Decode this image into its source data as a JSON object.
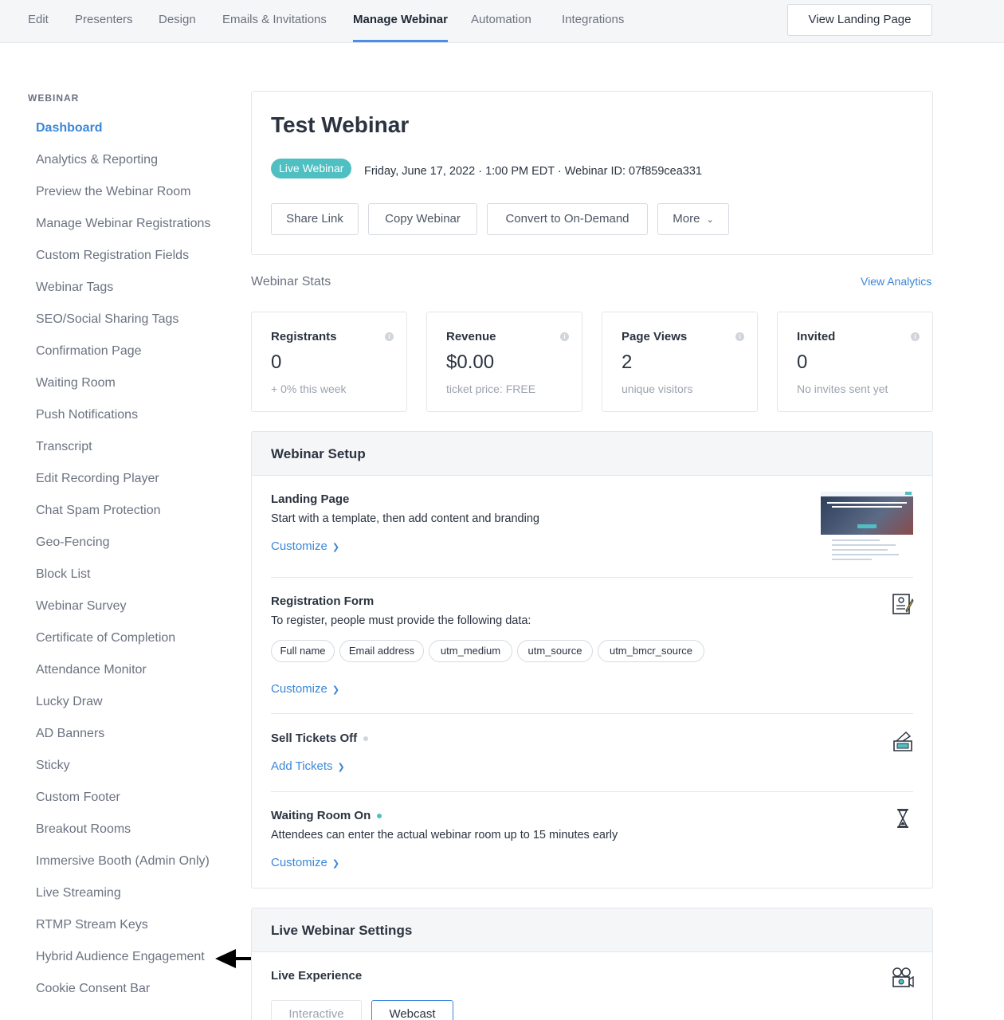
{
  "topnav": {
    "tabs": [
      "Edit",
      "Presenters",
      "Design",
      "Emails & Invitations",
      "Manage Webinar",
      "Automation",
      "Integrations"
    ],
    "active": "Manage Webinar",
    "view_landing": "View Landing Page"
  },
  "sidebar": {
    "heading": "WEBINAR",
    "items": [
      "Dashboard",
      "Analytics & Reporting",
      "Preview the Webinar Room",
      "Manage Webinar Registrations",
      "Custom Registration Fields",
      "Webinar Tags",
      "SEO/Social Sharing Tags",
      "Confirmation Page",
      "Waiting Room",
      "Push Notifications",
      "Transcript",
      "Edit Recording Player",
      "Chat Spam Protection",
      "Geo-Fencing",
      "Block List",
      "Webinar Survey",
      "Certificate of Completion",
      "Attendance Monitor",
      "Lucky Draw",
      "AD Banners",
      "Sticky",
      "Custom Footer",
      "Breakout Rooms",
      "Immersive Booth (Admin Only)",
      "Live Streaming",
      "RTMP Stream Keys",
      "Hybrid Audience Engagement",
      "Cookie Consent Bar"
    ]
  },
  "header": {
    "title": "Test Webinar",
    "badge": "Live Webinar",
    "meta": "Friday, June 17, 2022 · 1:00 PM EDT · Webinar ID: 07f859cea331",
    "buttons": {
      "share": "Share Link",
      "copy": "Copy Webinar",
      "convert": "Convert to On-Demand",
      "more": "More"
    }
  },
  "stats": {
    "label": "Webinar Stats",
    "view_analytics": "View Analytics",
    "cards": [
      {
        "label": "Registrants",
        "value": "0",
        "sub": "+ 0% this week"
      },
      {
        "label": "Revenue",
        "value": "$0.00",
        "sub": "ticket price: FREE"
      },
      {
        "label": "Page Views",
        "value": "2",
        "sub": "unique visitors"
      },
      {
        "label": "Invited",
        "value": "0",
        "sub": "No invites sent yet"
      }
    ]
  },
  "setup": {
    "heading": "Webinar Setup",
    "landing": {
      "title": "Landing Page",
      "desc": "Start with a template, then add content and branding",
      "link": "Customize"
    },
    "registration": {
      "title": "Registration Form",
      "desc": "To register, people must provide the following data:",
      "fields": [
        "Full name",
        "Email address",
        "utm_medium",
        "utm_source",
        "utm_bmcr_source"
      ],
      "link": "Customize"
    },
    "tickets": {
      "title": "Sell Tickets Off",
      "link": "Add Tickets"
    },
    "waiting": {
      "title": "Waiting Room On",
      "desc": "Attendees can enter the actual webinar room up to 15 minutes early",
      "link": "Customize"
    }
  },
  "live_settings": {
    "heading": "Live Webinar Settings",
    "experience": "Live Experience",
    "options": [
      "Interactive",
      "Webcast"
    ],
    "selected": "Webcast"
  },
  "colors": {
    "accent": "#3a87d8",
    "badge": "#4fbfc2",
    "status_on": "#4fbfc2",
    "status_off": "#d1d5db"
  }
}
